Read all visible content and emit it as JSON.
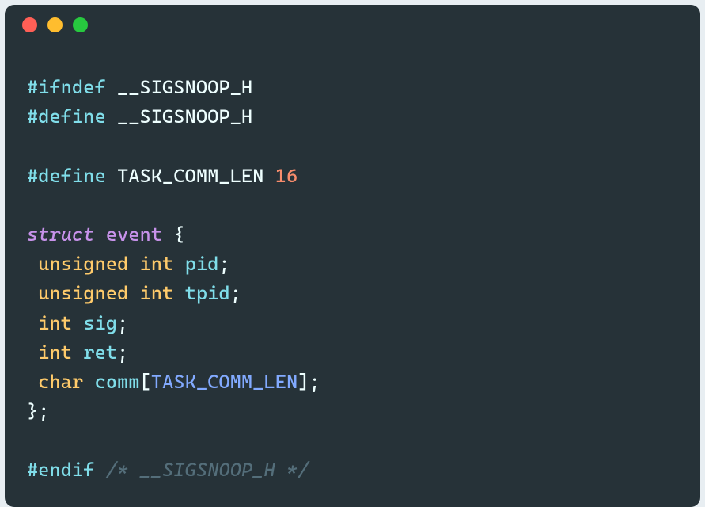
{
  "titlebar": {
    "dots": [
      "red",
      "yellow",
      "green"
    ]
  },
  "code": {
    "l1": {
      "prep": "#ifndef",
      "macro": "__SIGSNOOP_H"
    },
    "l2": {
      "prep": "#define",
      "macro": "__SIGSNOOP_H"
    },
    "l4": {
      "prep": "#define",
      "macro": "TASK_COMM_LEN",
      "val": "16"
    },
    "l6": {
      "kw": "struct",
      "name": "event",
      "open": "{"
    },
    "l7": {
      "ind": " ",
      "t1": "unsigned",
      "t2": "int",
      "var": "pid",
      "semi": ";"
    },
    "l8": {
      "ind": " ",
      "t1": "unsigned",
      "t2": "int",
      "var": "tpid",
      "semi": ";"
    },
    "l9": {
      "ind": " ",
      "t2": "int",
      "var": "sig",
      "semi": ";"
    },
    "l10": {
      "ind": " ",
      "t2": "int",
      "var": "ret",
      "semi": ";"
    },
    "l11": {
      "ind": " ",
      "t2": "char",
      "var": "comm",
      "lb": "[",
      "const": "TASK_COMM_LEN",
      "rb": "]",
      "semi": ";"
    },
    "l12": {
      "close": "};"
    },
    "l14": {
      "prep": "#endif",
      "cmt": "/* __SIGSNOOP_H */"
    }
  }
}
